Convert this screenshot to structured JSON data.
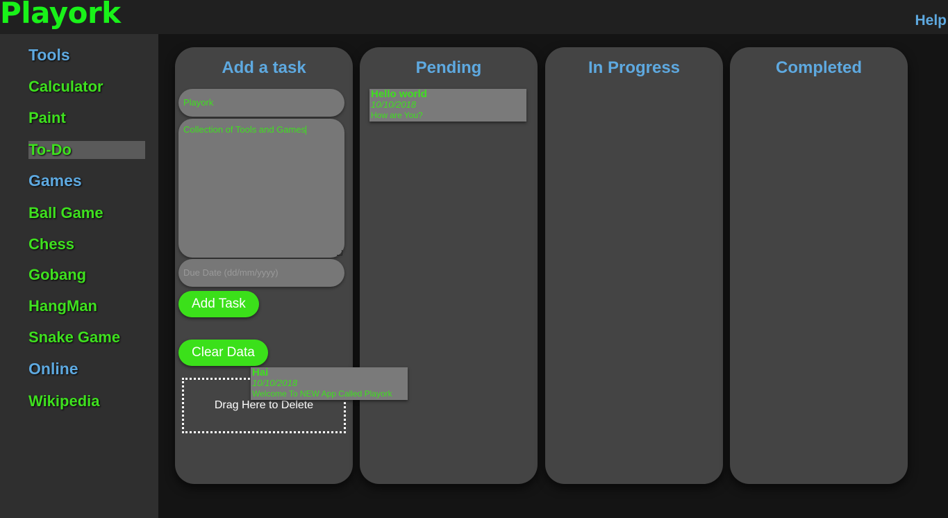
{
  "header": {
    "logo": "Playork",
    "help": "Help"
  },
  "sidebar": {
    "items": [
      {
        "label": "Tools"
      },
      {
        "label": "Calculator"
      },
      {
        "label": "Paint"
      },
      {
        "label": "To-Do"
      },
      {
        "label": "Games"
      },
      {
        "label": "Ball Game"
      },
      {
        "label": "Chess"
      },
      {
        "label": "Gobang"
      },
      {
        "label": "HangMan"
      },
      {
        "label": "Snake Game"
      },
      {
        "label": "Online"
      },
      {
        "label": "Wikipedia"
      }
    ]
  },
  "columns": {
    "add": {
      "title": "Add a task",
      "title_value": "Playork",
      "description_value": "Collection of Tools and Games",
      "due_placeholder": "Due Date (dd/mm/yyyy)",
      "add_button": "Add Task",
      "clear_button": "Clear Data",
      "drop_label": "Drag Here to Delete"
    },
    "pending": {
      "title": "Pending",
      "cards": [
        {
          "title": "Hello world",
          "date": "10/10/2018",
          "desc": "How are You?"
        }
      ]
    },
    "in_progress": {
      "title": "In Progress"
    },
    "completed": {
      "title": "Completed"
    }
  },
  "dragging_card": {
    "title": "Hai",
    "date": "10/10/2018",
    "desc": "Welcome To NEW App Called Playork"
  },
  "colors": {
    "accent_green": "#3fe01f",
    "accent_blue": "#5ea9e0",
    "logo_green": "#19f219"
  }
}
